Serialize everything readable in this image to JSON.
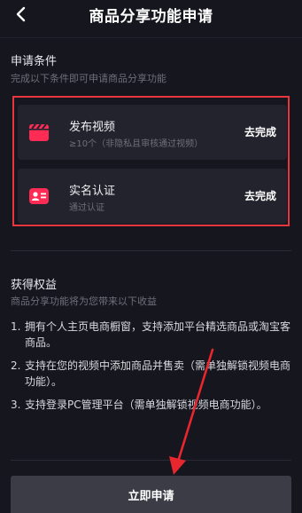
{
  "header": {
    "title": "商品分享功能申请"
  },
  "conditions": {
    "title": "申请条件",
    "subtitle": "完成以下条件即可申请商品分享功能",
    "items": [
      {
        "title": "发布视频",
        "desc": "≥10个（非隐私且审核通过视频）",
        "action": "去完成",
        "icon": "video-clapper-icon"
      },
      {
        "title": "实名认证",
        "desc": "通过认证",
        "action": "去完成",
        "icon": "id-card-icon"
      }
    ]
  },
  "benefits": {
    "title": "获得权益",
    "subtitle": "商品分享功能将为您带来以下收益",
    "items": [
      {
        "num": "1.",
        "text": "拥有个人主页电商橱窗，支持添加平台精选商品或淘宝客商品。"
      },
      {
        "num": "2.",
        "text": "支持在您的视频中添加商品并售卖（需单独解锁视频电商功能）。"
      },
      {
        "num": "3.",
        "text": "支持登录PC管理平台（需单独解锁视频电商功能）。"
      }
    ]
  },
  "apply_button": {
    "label": "立即申请"
  },
  "colors": {
    "background": "#16161e",
    "card": "#23232d",
    "icon_accent": "#fe2c55",
    "highlight": "#e8363e"
  }
}
